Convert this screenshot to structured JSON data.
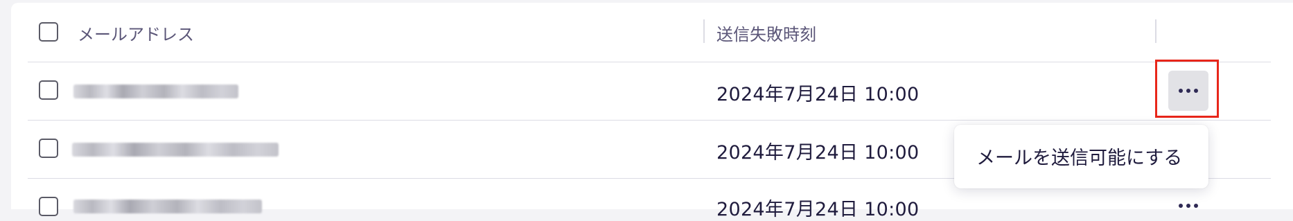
{
  "table": {
    "header": {
      "email_col": "メールアドレス",
      "failed_at_col": "送信失敗時刻"
    },
    "rows": [
      {
        "email": "redacted",
        "failed_at": "2024年7月24日 10:00"
      },
      {
        "email": "redacted",
        "failed_at": "2024年7月24日 10:00"
      },
      {
        "email": "redacted",
        "failed_at": "2024年7月24日 10:00"
      }
    ]
  },
  "row_menu": {
    "items": [
      "メールを送信可能にする"
    ]
  },
  "icons": {
    "row_actions": "more-horizontal-icon"
  },
  "colors": {
    "highlight": "#e8261a",
    "text": "#1f1b3d"
  }
}
